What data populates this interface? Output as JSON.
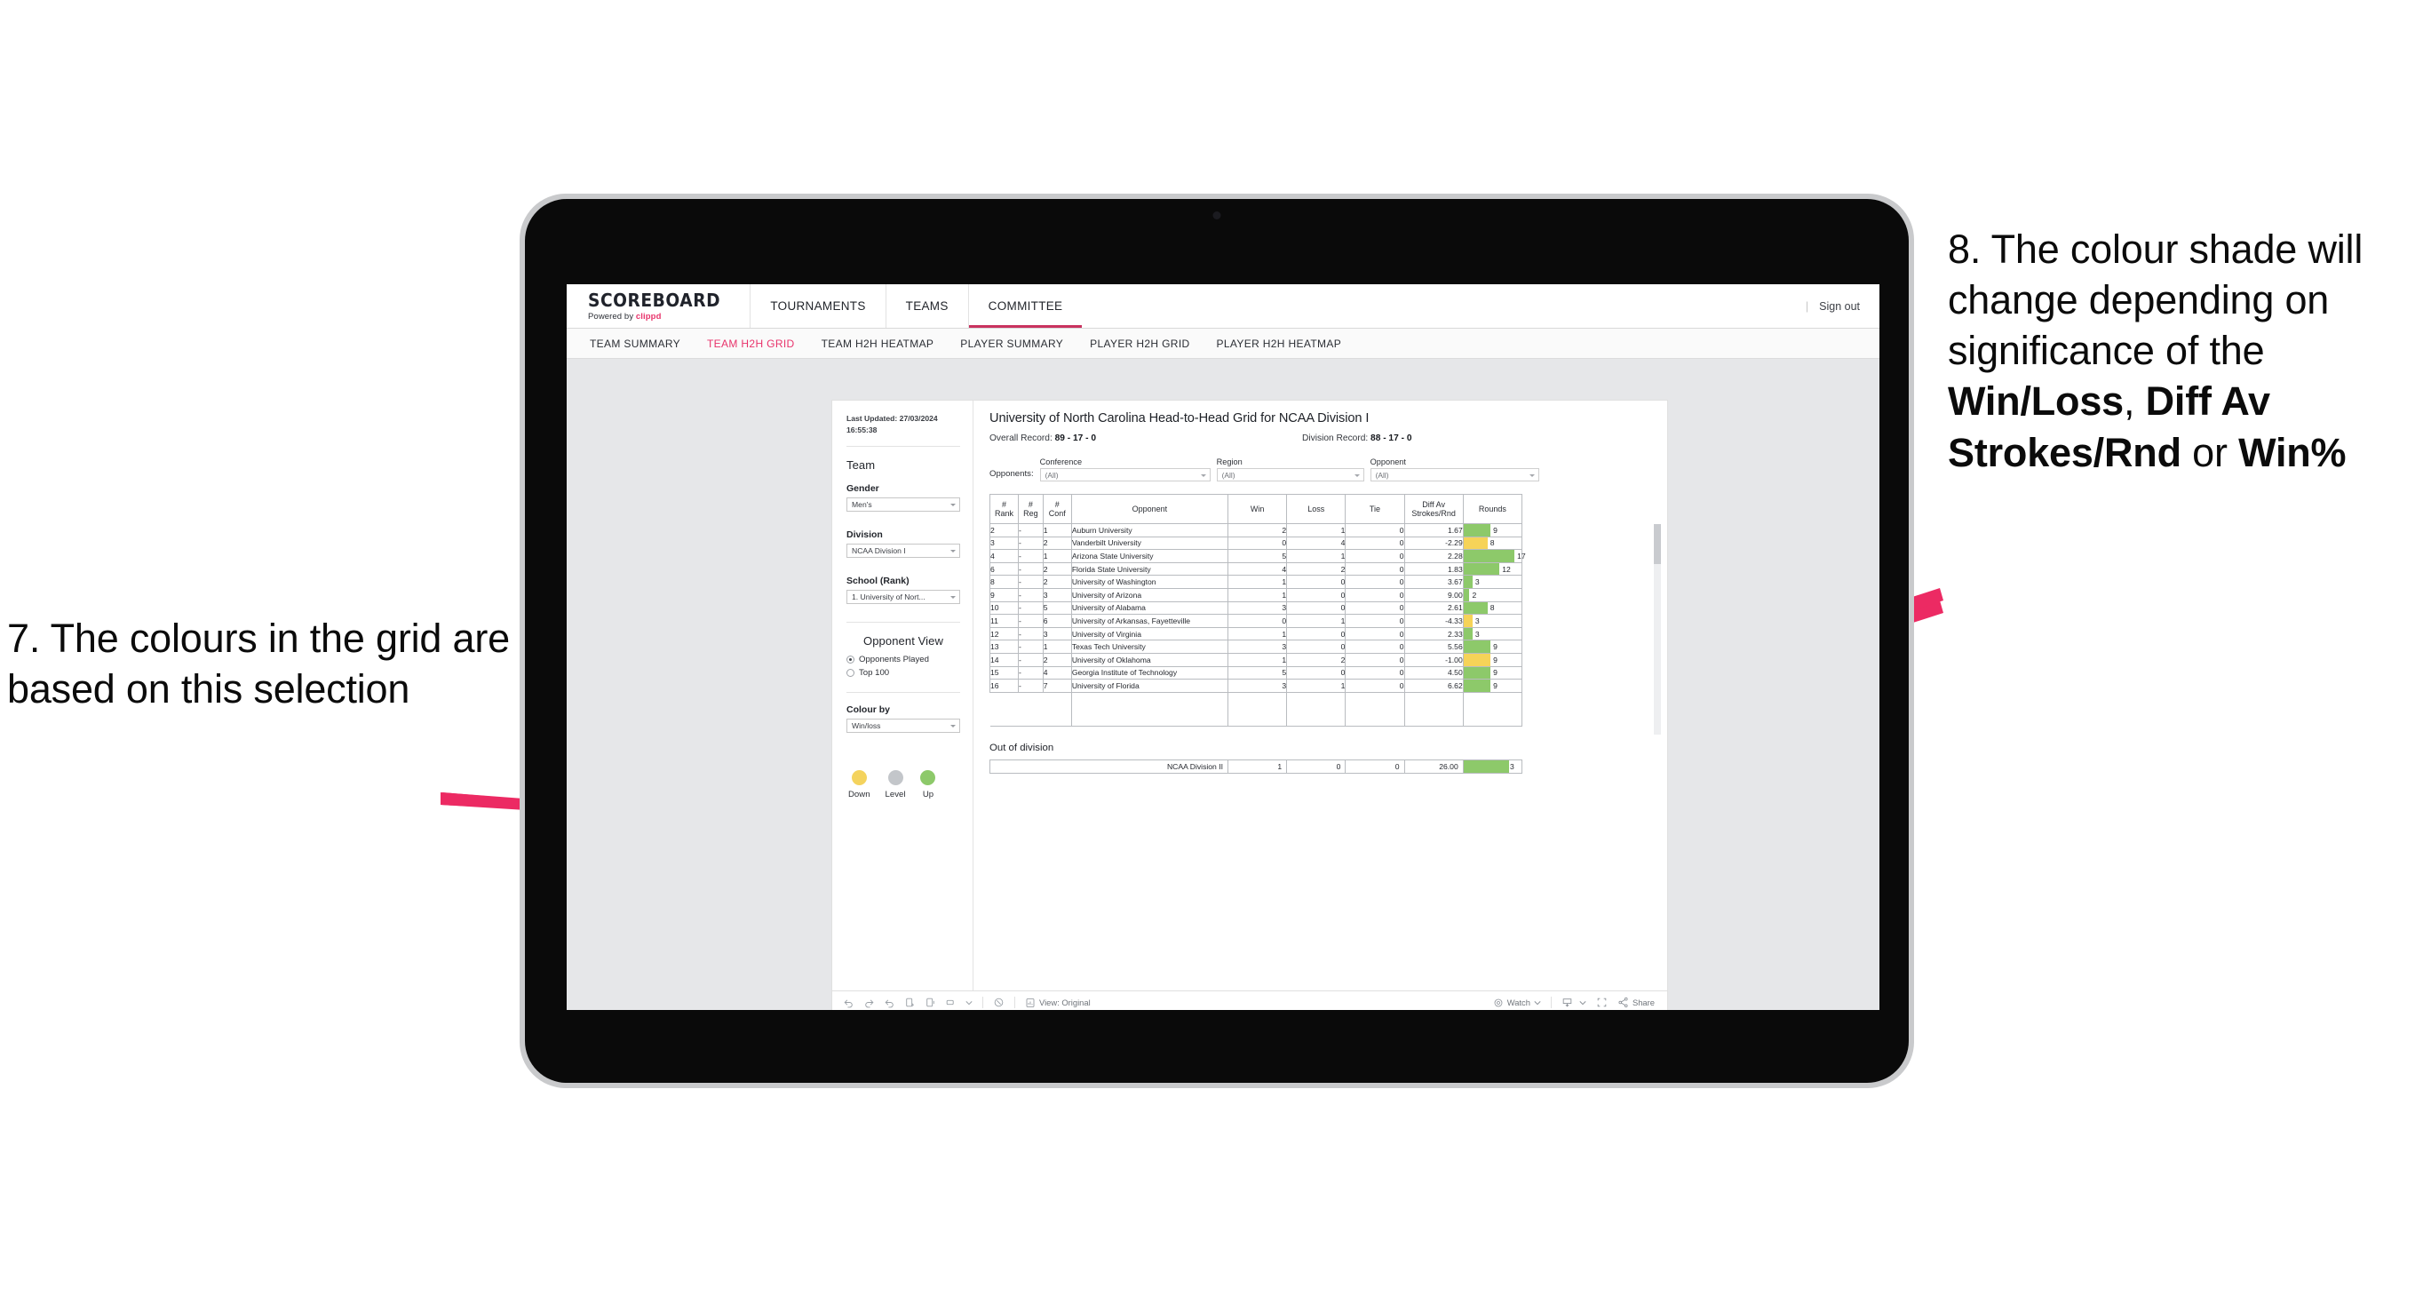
{
  "annotations": {
    "left": "7. The colours in the grid are based on this selection",
    "right_parts": [
      {
        "text": "8. The colour shade will change depending on significance of the ",
        "bold": false
      },
      {
        "text": "Win/Loss",
        "bold": true
      },
      {
        "text": ", ",
        "bold": false
      },
      {
        "text": "Diff Av Strokes/Rnd",
        "bold": true
      },
      {
        "text": " or ",
        "bold": false
      },
      {
        "text": "Win%",
        "bold": true
      }
    ],
    "arrow_color": "#ec2a63"
  },
  "app": {
    "brand": {
      "title": "SCOREBOARD",
      "powered_prefix": "Powered by ",
      "powered_name": "clippd"
    },
    "nav_tabs": [
      {
        "label": "TOURNAMENTS",
        "active": false
      },
      {
        "label": "TEAMS",
        "active": false
      },
      {
        "label": "COMMITTEE",
        "active": true
      }
    ],
    "nav_right": {
      "separator": "|",
      "sign_out": "Sign out"
    },
    "subnav": [
      {
        "label": "TEAM SUMMARY",
        "active": false
      },
      {
        "label": "TEAM H2H GRID",
        "active": true
      },
      {
        "label": "TEAM H2H HEATMAP",
        "active": false
      },
      {
        "label": "PLAYER SUMMARY",
        "active": false
      },
      {
        "label": "PLAYER H2H GRID",
        "active": false
      },
      {
        "label": "PLAYER H2H HEATMAP",
        "active": false
      }
    ]
  },
  "sidebar": {
    "last_updated": "Last Updated: 27/03/2024 16:55:38",
    "team_heading": "Team",
    "gender": {
      "label": "Gender",
      "value": "Men's"
    },
    "division": {
      "label": "Division",
      "value": "NCAA Division I"
    },
    "school": {
      "label": "School (Rank)",
      "value": "1. University of Nort..."
    },
    "opponent_view": {
      "heading": "Opponent View",
      "options": [
        {
          "label": "Opponents Played",
          "selected": true
        },
        {
          "label": "Top 100",
          "selected": false
        }
      ]
    },
    "colour_by": {
      "label": "Colour by",
      "value": "Win/loss"
    },
    "legend": [
      {
        "caption": "Down",
        "color": "#f4d35e"
      },
      {
        "caption": "Level",
        "color": "#c3c6ca"
      },
      {
        "caption": "Up",
        "color": "#8dc96a"
      }
    ]
  },
  "view": {
    "title": "University of North Carolina Head-to-Head Grid for NCAA Division I",
    "overall_record_label": "Overall Record: ",
    "overall_record_value": "89 - 17 - 0",
    "division_record_label": "Division Record: ",
    "division_record_value": "88 - 17 - 0",
    "opponents_label": "Opponents:",
    "filters": [
      {
        "label": "Conference",
        "value": "(All)"
      },
      {
        "label": "Region",
        "value": "(All)"
      },
      {
        "label": "Opponent",
        "value": "(All)"
      }
    ]
  },
  "chart_data": {
    "type": "table",
    "title": "University of North Carolina Head-to-Head Grid for NCAA Division I",
    "columns": [
      "# Rank",
      "# Reg",
      "# Conf",
      "Opponent",
      "Win",
      "Loss",
      "Tie",
      "Diff Av Strokes/Rnd",
      "Rounds"
    ],
    "column_headers_wrapped": [
      [
        "#",
        "Rank"
      ],
      [
        "#",
        "Reg"
      ],
      [
        "#",
        "Conf"
      ],
      [
        "Opponent"
      ],
      [
        "Win"
      ],
      [
        "Loss"
      ],
      [
        "Tie"
      ],
      [
        "Diff Av",
        "Strokes/Rnd"
      ],
      [
        "Rounds"
      ]
    ],
    "rounds_max": 17,
    "rows": [
      {
        "rank": "2",
        "reg": "-",
        "conf": "1",
        "opponent": "Auburn University",
        "win": "2",
        "loss": "1",
        "tie": "0",
        "diff": "1.67",
        "rounds": "9",
        "state": "g"
      },
      {
        "rank": "3",
        "reg": "-",
        "conf": "2",
        "opponent": "Vanderbilt University",
        "win": "0",
        "loss": "4",
        "tie": "0",
        "diff": "-2.29",
        "rounds": "8",
        "state": "y"
      },
      {
        "rank": "4",
        "reg": "-",
        "conf": "1",
        "opponent": "Arizona State University",
        "win": "5",
        "loss": "1",
        "tie": "0",
        "diff": "2.28",
        "rounds": "17",
        "state": "g"
      },
      {
        "rank": "6",
        "reg": "-",
        "conf": "2",
        "opponent": "Florida State University",
        "win": "4",
        "loss": "2",
        "tie": "0",
        "diff": "1.83",
        "rounds": "12",
        "state": "g"
      },
      {
        "rank": "8",
        "reg": "-",
        "conf": "2",
        "opponent": "University of Washington",
        "win": "1",
        "loss": "0",
        "tie": "0",
        "diff": "3.67",
        "rounds": "3",
        "state": "g"
      },
      {
        "rank": "9",
        "reg": "-",
        "conf": "3",
        "opponent": "University of Arizona",
        "win": "1",
        "loss": "0",
        "tie": "0",
        "diff": "9.00",
        "rounds": "2",
        "state": "g"
      },
      {
        "rank": "10",
        "reg": "-",
        "conf": "5",
        "opponent": "University of Alabama",
        "win": "3",
        "loss": "0",
        "tie": "0",
        "diff": "2.61",
        "rounds": "8",
        "state": "g"
      },
      {
        "rank": "11",
        "reg": "-",
        "conf": "6",
        "opponent": "University of Arkansas, Fayetteville",
        "win": "0",
        "loss": "1",
        "tie": "0",
        "diff": "-4.33",
        "rounds": "3",
        "state": "y"
      },
      {
        "rank": "12",
        "reg": "-",
        "conf": "3",
        "opponent": "University of Virginia",
        "win": "1",
        "loss": "0",
        "tie": "0",
        "diff": "2.33",
        "rounds": "3",
        "state": "g"
      },
      {
        "rank": "13",
        "reg": "-",
        "conf": "1",
        "opponent": "Texas Tech University",
        "win": "3",
        "loss": "0",
        "tie": "0",
        "diff": "5.56",
        "rounds": "9",
        "state": "g"
      },
      {
        "rank": "14",
        "reg": "-",
        "conf": "2",
        "opponent": "University of Oklahoma",
        "win": "1",
        "loss": "2",
        "tie": "0",
        "diff": "-1.00",
        "rounds": "9",
        "state": "y"
      },
      {
        "rank": "15",
        "reg": "-",
        "conf": "4",
        "opponent": "Georgia Institute of Technology",
        "win": "5",
        "loss": "0",
        "tie": "0",
        "diff": "4.50",
        "rounds": "9",
        "state": "g"
      },
      {
        "rank": "16",
        "reg": "-",
        "conf": "7",
        "opponent": "University of Florida",
        "win": "3",
        "loss": "1",
        "tie": "0",
        "diff": "6.62",
        "rounds": "9",
        "state": "g"
      }
    ],
    "out_of_division": {
      "title": "Out of division",
      "row": {
        "name": "NCAA Division II",
        "win": "1",
        "loss": "0",
        "tie": "0",
        "diff": "26.00",
        "rounds": "3",
        "state": "g"
      }
    }
  },
  "toolbar": {
    "undo": "undo-icon",
    "redo": "redo-icon",
    "revert": "revert-icon",
    "refresh": "refresh-icon",
    "pause": "pause-icon",
    "alerts": "alerts-icon",
    "view_label": "View: Original",
    "watch_label": "Watch",
    "share_label": "Share"
  }
}
